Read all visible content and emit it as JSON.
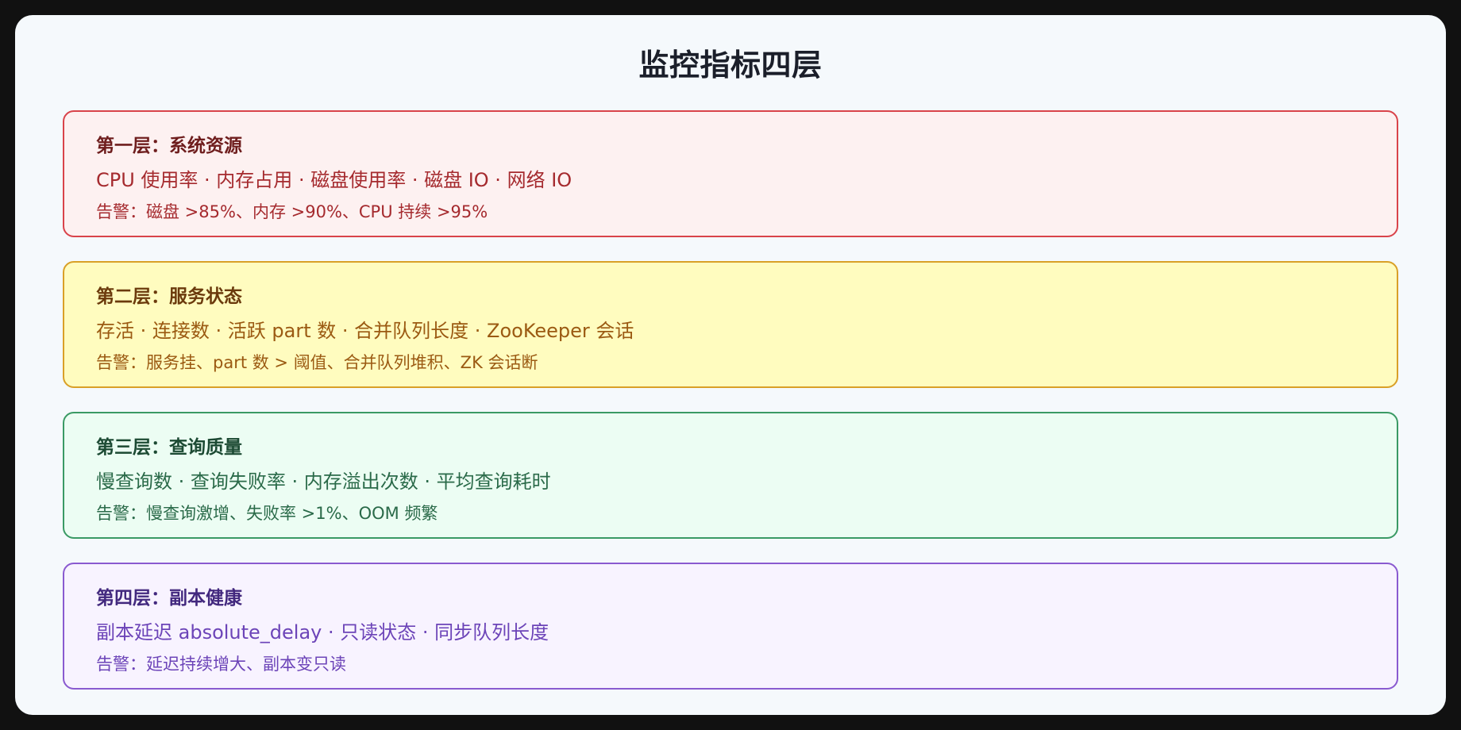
{
  "title": "监控指标四层",
  "layers": [
    {
      "heading": "第一层：系统资源",
      "metrics": "CPU 使用率 · 内存占用 · 磁盘使用率 · 磁盘 IO · 网络 IO",
      "alert_label": "告警：",
      "alert_text": "磁盘 >85%、内存 >90%、CPU 持续 >95%",
      "colors": {
        "border": "#d9434a",
        "background": "#fdf1f1",
        "heading": "#6e1d1d",
        "text": "#a52a2e"
      }
    },
    {
      "heading": "第二层：服务状态",
      "metrics": "存活 · 连接数 · 活跃 part 数 · 合并队列长度 · ZooKeeper 会话",
      "alert_label": "告警：",
      "alert_text": "服务挂、part 数 > 阈值、合并队列堆积、ZK 会话断",
      "colors": {
        "border": "#d9a027",
        "background": "#fffcbf",
        "heading": "#6b3a0c",
        "text": "#9b5a12"
      }
    },
    {
      "heading": "第三层：查询质量",
      "metrics": "慢查询数 · 查询失败率 · 内存溢出次数 · 平均查询耗时",
      "alert_label": "告警：",
      "alert_text": "慢查询激增、失败率 >1%、OOM 频繁",
      "colors": {
        "border": "#3a9a64",
        "background": "#ecfdf3",
        "heading": "#1c4a33",
        "text": "#2a6a49"
      }
    },
    {
      "heading": "第四层：副本健康",
      "metrics": "副本延迟 absolute_delay · 只读状态 · 同步队列长度",
      "alert_label": "告警：",
      "alert_text": "延迟持续增大、副本变只读",
      "colors": {
        "border": "#8a5ad0",
        "background": "#f8f3ff",
        "heading": "#42287e",
        "text": "#6c44b8"
      }
    }
  ]
}
